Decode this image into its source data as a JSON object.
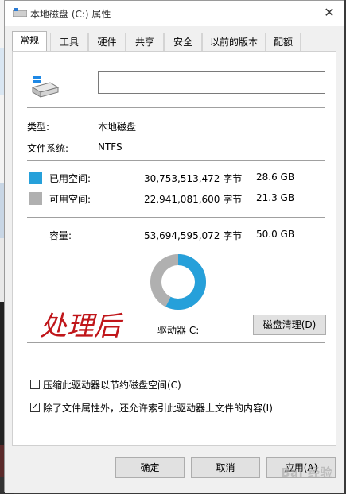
{
  "window": {
    "title": "本地磁盘 (C:) 属性",
    "close_glyph": "✕"
  },
  "tabs": [
    {
      "label": "常规",
      "active": true
    },
    {
      "label": "工具"
    },
    {
      "label": "硬件"
    },
    {
      "label": "共享"
    },
    {
      "label": "安全"
    },
    {
      "label": "以前的版本"
    },
    {
      "label": "配额"
    }
  ],
  "general": {
    "name_value": "",
    "type_label": "类型:",
    "type_value": "本地磁盘",
    "fs_label": "文件系统:",
    "fs_value": "NTFS",
    "used": {
      "label": "已用空间:",
      "bytes": "30,753,513,472 字节",
      "size": "28.6 GB",
      "color": "#26a0da"
    },
    "free": {
      "label": "可用空间:",
      "bytes": "22,941,081,600 字节",
      "size": "21.3 GB",
      "color": "#b0b0b0"
    },
    "capacity": {
      "label": "容量:",
      "bytes": "53,694,595,072 字节",
      "size": "50.0 GB"
    },
    "used_fraction": 0.573,
    "drive_label": "驱动器 C:",
    "cleanup_button": "磁盘清理(D)",
    "compress_label": "压缩此驱动器以节约磁盘空间(C)",
    "compress_checked": false,
    "index_label": "除了文件属性外，还允许索引此驱动器上文件的内容(I)",
    "index_checked": true,
    "annotation": "处理后"
  },
  "buttons": {
    "ok": "确定",
    "cancel": "取消",
    "apply": "应用(A)"
  },
  "watermark": "Bai 经验"
}
